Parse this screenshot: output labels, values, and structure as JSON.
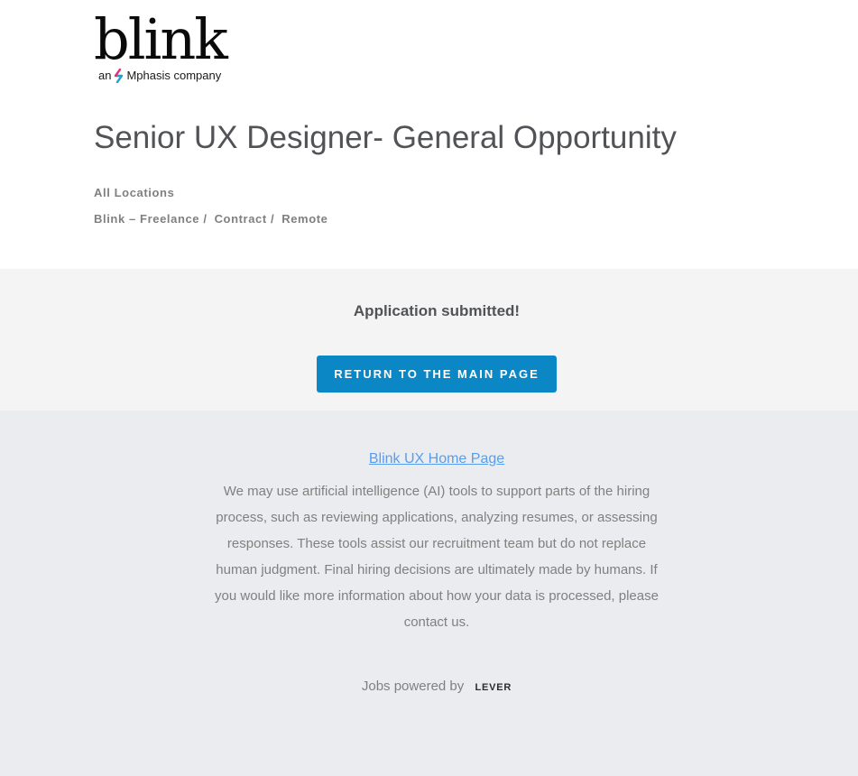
{
  "brand": {
    "name": "blink",
    "tagline_prefix": "an",
    "tagline_company": "Mphasis company",
    "icon": "mphasis-logo-mark"
  },
  "job": {
    "title": "Senior UX Designer- General Opportunity",
    "locations_label": "All Locations",
    "categories": [
      "Blink – Freelance /",
      "Contract /",
      "Remote"
    ]
  },
  "application": {
    "status_message": "Application submitted!",
    "return_button_label": "RETURN TO THE MAIN PAGE"
  },
  "footer": {
    "home_link_label": "Blink UX Home Page",
    "ai_notice": "We may use artificial intelligence (AI) tools to support parts of the hiring process, such as reviewing applications, analyzing resumes, or assessing responses. These tools assist our recruitment team but do not replace human judgment. Final hiring decisions are ultimately made by humans. If you would like more information about how your data is processed, please contact us.",
    "powered_by": "Jobs powered by",
    "provider": "LEVER"
  },
  "colors": {
    "primary_button": "#0c87c5",
    "link": "#579eee",
    "submitted_bg": "#f4f4f4",
    "footer_bg": "#ebecef"
  }
}
